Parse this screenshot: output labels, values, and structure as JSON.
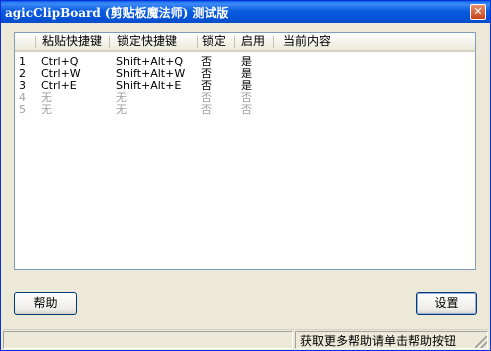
{
  "window": {
    "title": "agicClipBoard (剪贴板魔法师) 测试版",
    "close_glyph": "✕"
  },
  "list": {
    "columns": [
      "粘贴快捷键",
      "锁定快捷键",
      "锁定",
      "启用",
      "当前内容"
    ],
    "rows": [
      {
        "index": "1",
        "paste_key": "Ctrl+Q",
        "lock_key": "Shift+Alt+Q",
        "locked": "否",
        "enabled": "是",
        "content": "",
        "disabled": false
      },
      {
        "index": "2",
        "paste_key": "Ctrl+W",
        "lock_key": "Shift+Alt+W",
        "locked": "否",
        "enabled": "是",
        "content": "",
        "disabled": false
      },
      {
        "index": "3",
        "paste_key": "Ctrl+E",
        "lock_key": "Shift+Alt+E",
        "locked": "否",
        "enabled": "是",
        "content": "",
        "disabled": false
      },
      {
        "index": "4",
        "paste_key": "无",
        "lock_key": "无",
        "locked": "否",
        "enabled": "否",
        "content": "",
        "disabled": true
      },
      {
        "index": "5",
        "paste_key": "无",
        "lock_key": "无",
        "locked": "否",
        "enabled": "否",
        "content": "",
        "disabled": true
      }
    ]
  },
  "buttons": {
    "help": "帮助",
    "settings": "设置"
  },
  "statusbar": {
    "left": "",
    "right": "获取更多帮助请单击帮助按钮"
  }
}
